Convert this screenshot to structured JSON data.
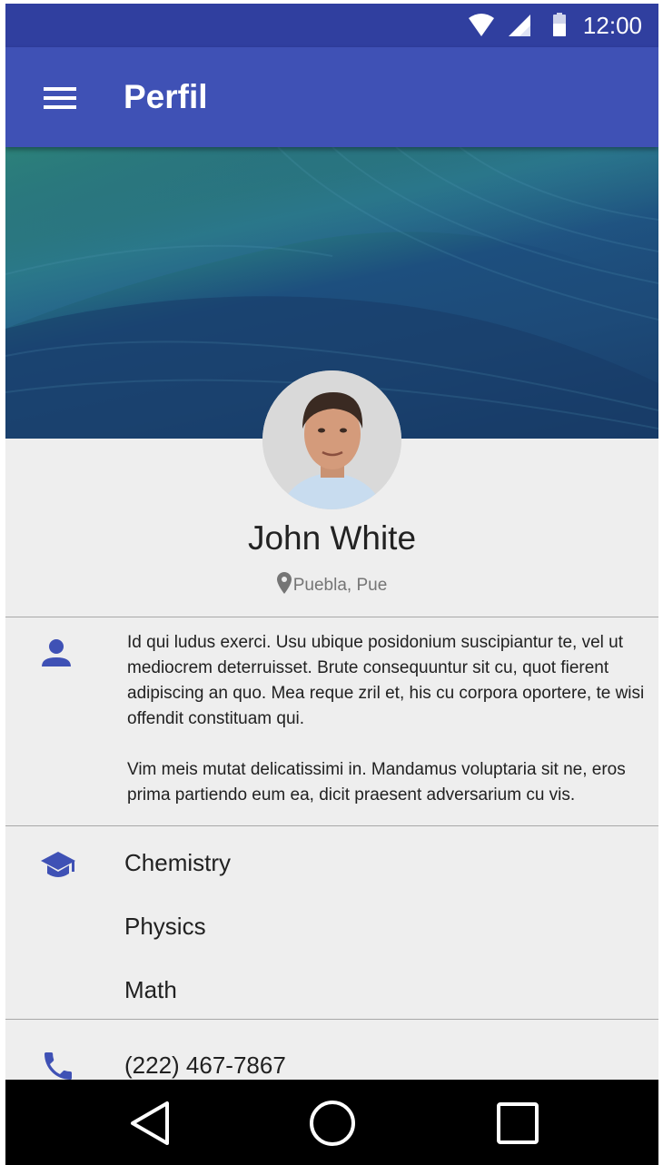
{
  "status_bar": {
    "time": "12:00",
    "icons": [
      "wifi-icon",
      "signal-icon",
      "battery-icon"
    ]
  },
  "app_bar": {
    "title": "Perfil",
    "menu_icon": "menu-icon"
  },
  "profile": {
    "name": "John White",
    "location": "Puebla, Pue",
    "location_icon": "location-pin-icon"
  },
  "about": {
    "icon": "person-icon",
    "paragraphs": [
      "Id qui ludus exerci. Usu ubique posidonium suscipiantur te, vel ut mediocrem deterruisset. Brute consequuntur sit cu, quot fierent adipiscing an quo. Mea reque zril et, his cu corpora oportere, te wisi offendit constituam qui.",
      "Vim meis mutat delicatissimi in. Mandamus voluptaria sit ne, eros prima partiendo eum ea, dicit praesent adversarium cu vis."
    ]
  },
  "education": {
    "icon": "school-icon",
    "subjects": [
      "Chemistry",
      "Physics",
      "Math"
    ]
  },
  "contact": {
    "icon": "phone-icon",
    "phone": "(222) 467-7867"
  },
  "nav_bar": {
    "buttons": [
      "back-icon",
      "home-icon",
      "recents-icon"
    ]
  },
  "colors": {
    "primary": "#3f51b5",
    "primary_dark": "#303f9f",
    "background": "#eeeeee",
    "text": "#212121",
    "secondary_text": "#757575"
  }
}
